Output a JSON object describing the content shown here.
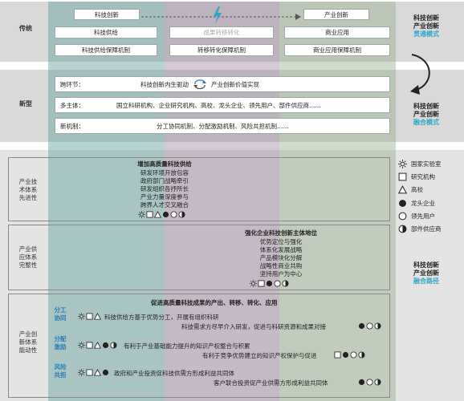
{
  "bands": {
    "traditional_label": "传统",
    "new_label": "新型"
  },
  "traditional": {
    "top_left": "科技创新",
    "top_right": "产业创新",
    "row1": [
      "科技供给",
      "成果转移转化",
      "商业应用"
    ],
    "row2": [
      "科技供给保障机制",
      "转移转化保障机制",
      "商业应用保障机制"
    ]
  },
  "new_model": {
    "row1_label": "跨环节：",
    "row1_left": "科技创新内生驱动",
    "row1_right": "产业创新价值实现",
    "row2_label": "多主体：",
    "row2_text": "国立科研机构、企业研究机构、高校、龙头企业、领先用户、部件供应商……",
    "row3_label": "新机制：",
    "row3_text": "分工协同机制、分配激励机制、风险共担机制……"
  },
  "right_titles": {
    "t1": [
      "科技创新",
      "产业创新",
      "贯通模式"
    ],
    "t2": [
      "科技创新",
      "产业创新",
      "融合模式"
    ],
    "t3": [
      "科技创新",
      "产业创新",
      "融合路径"
    ]
  },
  "sections": {
    "s1_label": [
      "产业技",
      "术体系",
      "先进性"
    ],
    "s1_title": "增加高质量科技供给",
    "s1_lines": [
      "研发环境开放包容",
      "政府部门战略牵引",
      "研发组织各抒所长",
      "产业力量深度参与",
      "跨界人才交叉融合"
    ],
    "s2_label": [
      "产业供",
      "应体系",
      "完整性"
    ],
    "s2_title": "强化企业科技创新主体地位",
    "s2_lines": [
      "优势定位与强化",
      "体系化发展战略",
      "产品模块化分解",
      "战略性商业共购",
      "坚持用户为中心"
    ],
    "s3_label": [
      "产业创",
      "新体系",
      "能动性"
    ],
    "s3_title": "促进高质量科技成果的产出、转移、转化、应用",
    "sub1": [
      "分工",
      "协同"
    ],
    "sub1_line1": "科技供给方基于优势分工，开展有组织科研",
    "sub1_line2": "科技需求方尽早介入研发，促进与科研资源和成果对接",
    "sub2": [
      "分配",
      "激励"
    ],
    "sub2_line1": "有利于产业基础能力提升的知识产权整合与积累",
    "sub2_line2": "有利于竞争优势建立的知识产权保护与促进",
    "sub3": [
      "风险",
      "共担"
    ],
    "sub3_line1": "政府和产业投资促科技供需方形成利益共同体",
    "sub3_line2": "客户联合投资促产业供需方形成利益共同体"
  },
  "legend": [
    {
      "icon": "sun",
      "label": "国家实验室"
    },
    {
      "icon": "square",
      "label": "研究机构"
    },
    {
      "icon": "triangle",
      "label": "高校"
    },
    {
      "icon": "filled-circle",
      "label": "龙头企业"
    },
    {
      "icon": "circle",
      "label": "领先用户"
    },
    {
      "icon": "half-circle",
      "label": "部件供应商"
    }
  ],
  "colors": {
    "teal": "#60a09c",
    "purple": "#96789a",
    "green": "#96af8c",
    "accent": "#2fa7c9",
    "sub_label": "#2a7fb5"
  }
}
